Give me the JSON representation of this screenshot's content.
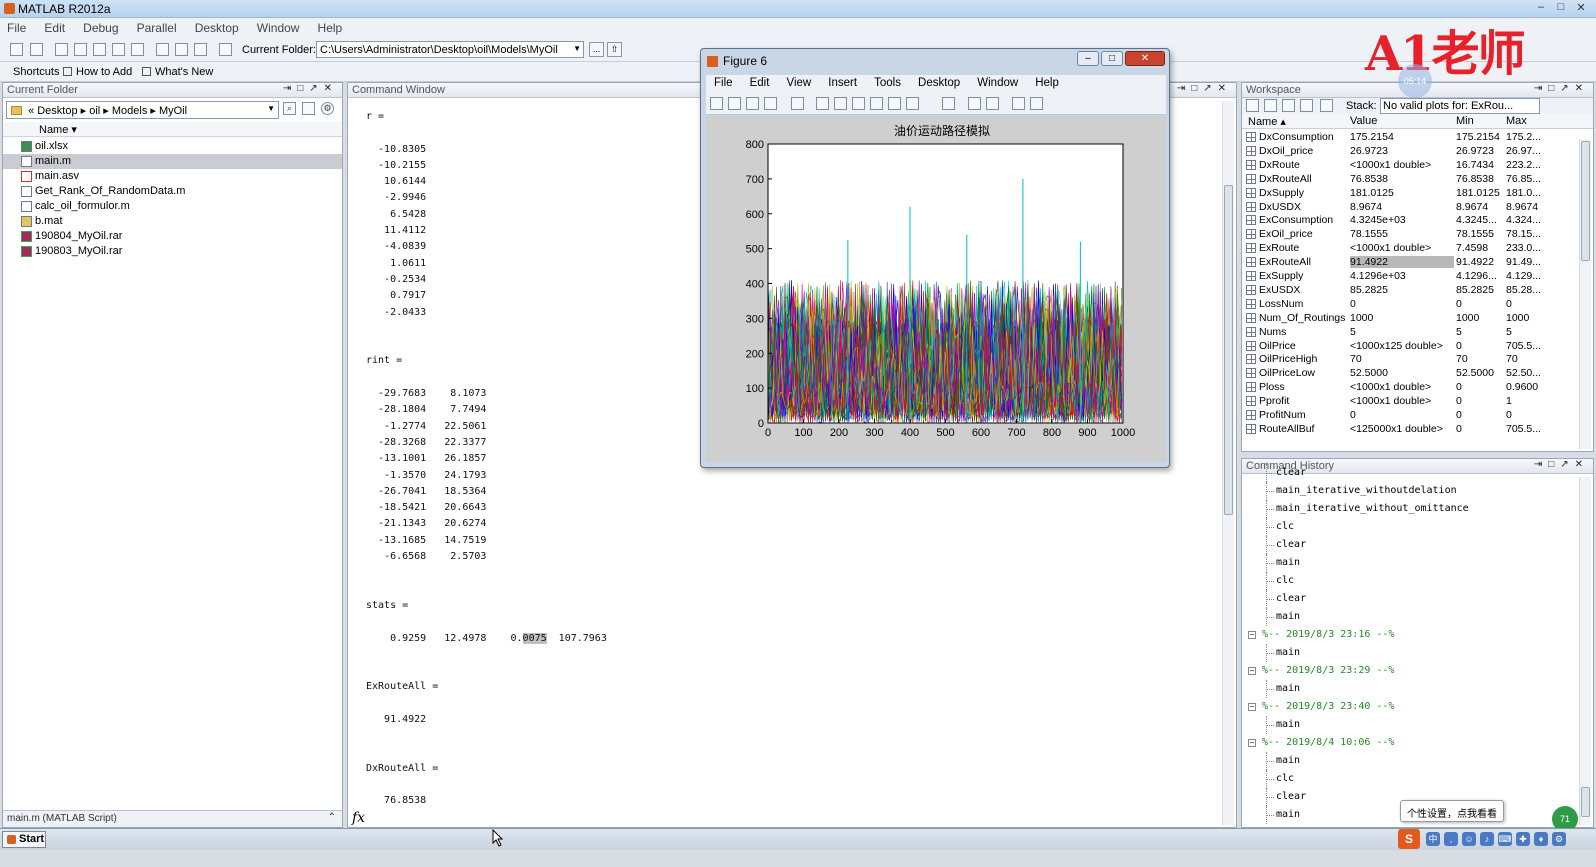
{
  "app": {
    "title": "MATLAB  R2012a"
  },
  "window_controls": [
    "–",
    "□",
    "✕"
  ],
  "menu": [
    "File",
    "Edit",
    "Debug",
    "Parallel",
    "Desktop",
    "Window",
    "Help"
  ],
  "toolbar": {
    "current_folder_label": "Current Folder:",
    "current_folder_value": "C:\\Users\\Administrator\\Desktop\\oil\\Models\\MyOil",
    "browse_label": "..."
  },
  "shortcuts": {
    "label": "Shortcuts",
    "how_to_add": "How to Add",
    "whats_new": "What's New"
  },
  "current_folder": {
    "title": "Current Folder",
    "path": "« Desktop ▸ oil ▸ Models ▸ MyOil",
    "name_header": "Name ▾",
    "files": [
      {
        "name": "oil.xlsx",
        "icon": "excel-file-icon"
      },
      {
        "name": "main.m",
        "icon": "m-file-icon",
        "selected": true
      },
      {
        "name": "main.asv",
        "icon": "asv-file-icon"
      },
      {
        "name": "Get_Rank_Of_RandomData.m",
        "icon": "function-file-icon"
      },
      {
        "name": "calc_oil_formulor.m",
        "icon": "function-file-icon"
      },
      {
        "name": "b.mat",
        "icon": "mat-file-icon"
      },
      {
        "name": "190804_MyOil.rar",
        "icon": "rar-file-icon"
      },
      {
        "name": "190803_MyOil.rar",
        "icon": "rar-file-icon"
      }
    ],
    "footer": "main.m (MATLAB Script)"
  },
  "command_window": {
    "title": "Command Window",
    "output_before": "r =\n\n  -10.8305\n  -10.2155\n   10.6144\n   -2.9946\n    6.5428\n   11.4112\n   -4.0839\n    1.0611\n   -0.2534\n    0.7917\n   -2.0433\n\n\nrint =\n\n  -29.7683    8.1073\n  -28.1804    7.7494\n   -1.2774   22.5061\n  -28.3268   22.3377\n  -13.1001   26.1857\n   -1.3570   24.1793\n  -26.7041   18.5364\n  -18.5421   20.6643\n  -21.1343   20.6274\n  -13.1685   14.7519\n   -6.6568    2.5703\n\n\nstats =\n\n    0.9259   12.4978    0.",
    "output_selected": "0075",
    "output_after": "  107.7963\n\n\nExRouteAll =\n\n   91.4922\n\n\nDxRouteAll =\n\n   76.8538",
    "prompt_icon": "fx"
  },
  "figure": {
    "title": "Figure 6",
    "menu": [
      "File",
      "Edit",
      "View",
      "Insert",
      "Tools",
      "Desktop",
      "Window",
      "Help"
    ],
    "chart_data": {
      "type": "line",
      "title": "油价运动路径模拟",
      "xlabel": "",
      "ylabel": "",
      "xlim": [
        0,
        1000
      ],
      "ylim": [
        0,
        800
      ],
      "xticks": [
        "0",
        "100",
        "200",
        "300",
        "400",
        "500",
        "600",
        "700",
        "800",
        "900",
        "1000"
      ],
      "yticks": [
        "0",
        "100",
        "200",
        "300",
        "400",
        "500",
        "600",
        "700",
        "800"
      ],
      "grid": false,
      "series_count": 125,
      "series_colors": [
        "#0000ff",
        "#008000",
        "#ff0000",
        "#00bfbf",
        "#bf00bf",
        "#bfbf00",
        "#404040"
      ],
      "peaks": [
        {
          "x": 400,
          "y": 620
        },
        {
          "x": 718,
          "y": 700
        },
        {
          "x": 225,
          "y": 525
        },
        {
          "x": 560,
          "y": 540
        },
        {
          "x": 880,
          "y": 520
        }
      ]
    }
  },
  "workspace": {
    "title": "Workspace",
    "stack_label": "Stack:",
    "plot_selector": "No valid plots for: ExRou...",
    "headers": {
      "name": "Name ▴",
      "value": "Value",
      "min": "Min",
      "max": "Max"
    },
    "vars": [
      {
        "name": "DxConsumption",
        "value": "175.2154",
        "min": "175.2154",
        "max": "175.2..."
      },
      {
        "name": "DxOil_price",
        "value": "26.9723",
        "min": "26.9723",
        "max": "26.97..."
      },
      {
        "name": "DxRoute",
        "value": "<1000x1 double>",
        "min": "16.7434",
        "max": "223.2..."
      },
      {
        "name": "DxRouteAll",
        "value": "76.8538",
        "min": "76.8538",
        "max": "76.85..."
      },
      {
        "name": "DxSupply",
        "value": "181.0125",
        "min": "181.0125",
        "max": "181.0..."
      },
      {
        "name": "DxUSDX",
        "value": "8.9674",
        "min": "8.9674",
        "max": "8.9674"
      },
      {
        "name": "ExConsumption",
        "value": "4.3245e+03",
        "min": "4.3245...",
        "max": "4.324..."
      },
      {
        "name": "ExOil_price",
        "value": "78.1555",
        "min": "78.1555",
        "max": "78.15..."
      },
      {
        "name": "ExRoute",
        "value": "<1000x1 double>",
        "min": "7.4598",
        "max": "233.0..."
      },
      {
        "name": "ExRouteAll",
        "value": "91.4922",
        "min": "91.4922",
        "max": "91.49...",
        "highlight": true
      },
      {
        "name": "ExSupply",
        "value": "4.1296e+03",
        "min": "4.1296...",
        "max": "4.129..."
      },
      {
        "name": "ExUSDX",
        "value": "85.2825",
        "min": "85.2825",
        "max": "85.28..."
      },
      {
        "name": "LossNum",
        "value": "0",
        "min": "0",
        "max": "0"
      },
      {
        "name": "Num_Of_Routings",
        "value": "1000",
        "min": "1000",
        "max": "1000"
      },
      {
        "name": "Nums",
        "value": "5",
        "min": "5",
        "max": "5"
      },
      {
        "name": "OilPrice",
        "value": "<1000x125 double>",
        "min": "0",
        "max": "705.5..."
      },
      {
        "name": "OilPriceHigh",
        "value": "70",
        "min": "70",
        "max": "70"
      },
      {
        "name": "OilPriceLow",
        "value": "52.5000",
        "min": "52.5000",
        "max": "52.50..."
      },
      {
        "name": "Ploss",
        "value": "<1000x1 double>",
        "min": "0",
        "max": "0.9600"
      },
      {
        "name": "Pprofit",
        "value": "<1000x1 double>",
        "min": "0",
        "max": "1"
      },
      {
        "name": "ProfitNum",
        "value": "0",
        "min": "0",
        "max": "0"
      },
      {
        "name": "RouteAllBuf",
        "value": "<125000x1 double>",
        "min": "0",
        "max": "705.5..."
      }
    ]
  },
  "history": {
    "title": "Command History",
    "lines": [
      {
        "text": "clear",
        "kind": "cmd"
      },
      {
        "text": "main_iterative_withoutdelation",
        "kind": "cmd"
      },
      {
        "text": "main_iterative_without_omittance",
        "kind": "cmd"
      },
      {
        "text": "clc",
        "kind": "cmd"
      },
      {
        "text": "clear",
        "kind": "cmd"
      },
      {
        "text": "main",
        "kind": "cmd"
      },
      {
        "text": "clc",
        "kind": "cmd"
      },
      {
        "text": "clear",
        "kind": "cmd"
      },
      {
        "text": "main",
        "kind": "cmd"
      },
      {
        "text": "%-- 2019/8/3 23:16 --%",
        "kind": "date"
      },
      {
        "text": "main",
        "kind": "cmd"
      },
      {
        "text": "%-- 2019/8/3 23:29 --%",
        "kind": "date"
      },
      {
        "text": "main",
        "kind": "cmd"
      },
      {
        "text": "%-- 2019/8/3 23:40 --%",
        "kind": "date"
      },
      {
        "text": "main",
        "kind": "cmd"
      },
      {
        "text": "%-- 2019/8/4 10:06 --%",
        "kind": "date"
      },
      {
        "text": "main",
        "kind": "cmd"
      },
      {
        "text": "clc",
        "kind": "cmd"
      },
      {
        "text": "clear",
        "kind": "cmd"
      },
      {
        "text": "main",
        "kind": "cmd"
      }
    ]
  },
  "overlay": {
    "watermark": "A1老师",
    "timer": "05:14",
    "tooltip": "个性设置，点我看看",
    "bubble": "71"
  },
  "taskbar": {
    "start": "Start",
    "ime": "S"
  },
  "colors": {
    "accent": "#d7601f",
    "selection": "#c9ccd1",
    "history_date": "#228b22",
    "watermark": "#e8202a"
  }
}
